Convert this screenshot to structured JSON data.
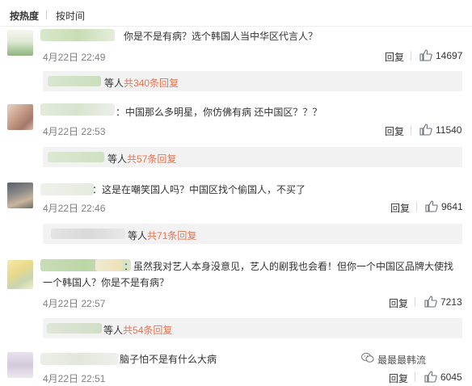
{
  "sort": {
    "active": "按热度",
    "inactive": "按时间"
  },
  "comments": [
    {
      "text": "你是不是有病？选个韩国人当中华区代言人？",
      "date": "4月22日 22:49",
      "reply_label": "回复",
      "likes": "14697",
      "thread": {
        "suffix_before": "等人",
        "count": "共340条回复"
      }
    },
    {
      "text": "：中国那么多明星，你仿佛有病 还中国区？？？",
      "date": "4月22日 22:53",
      "reply_label": "回复",
      "likes": "11540",
      "thread": {
        "suffix_before": "等人",
        "count": "共57条回复"
      }
    },
    {
      "text": "：这是在嘲笑国人吗？中国区找个偷国人，不买了",
      "date": "4月22日 22:46",
      "reply_label": "回复",
      "likes": "9641",
      "thread": {
        "suffix_before": "等人",
        "count": "共71条回复"
      }
    },
    {
      "text_line1": "：虽然我对艺人本身没意见，艺人的剧我也会看！但你一个中国区品牌大使找",
      "text_line2": "一个韩国人？你是不是有病？",
      "date": "4月22日 22:57",
      "reply_label": "回复",
      "likes": "7213",
      "thread": {
        "suffix_before": "等人",
        "count": "共54条回复"
      }
    },
    {
      "text": "脑子怕不是有什么大病",
      "date": "4月22日 22:51",
      "reply_label": "回复",
      "likes": "6045"
    }
  ],
  "watermark": "最最最韩流",
  "colors": {
    "accent": "#eb7350",
    "blur_green": "#c9dfb9",
    "blur_gray": "#dcdcdc"
  }
}
